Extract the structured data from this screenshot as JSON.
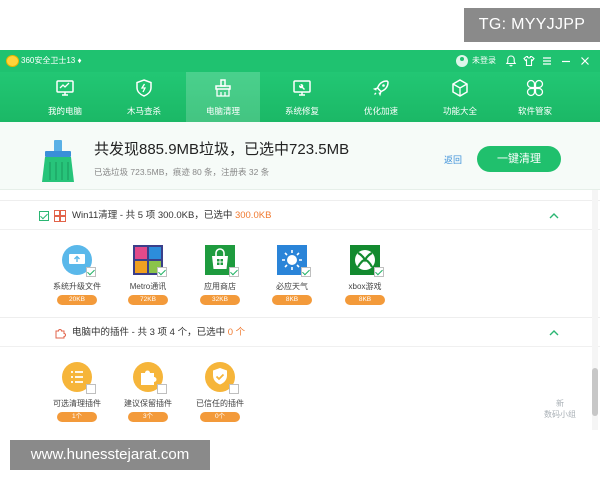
{
  "watermarks": {
    "top": "TG: MYYJJPP",
    "bottom": "www.hunesstejarat.com",
    "corner": [
      "新",
      "数码小组"
    ]
  },
  "titlebar": {
    "title": "360安全卫士13 ♦",
    "login": "未登录",
    "controls": [
      "bell-icon",
      "shirt-icon",
      "menu-icon",
      "minimize-icon",
      "close-icon"
    ]
  },
  "nav": {
    "items": [
      {
        "label": "我的电脑",
        "icon": "monitor-icon"
      },
      {
        "label": "木马查杀",
        "icon": "shield-icon"
      },
      {
        "label": "电脑清理",
        "icon": "broom-icon",
        "active": true
      },
      {
        "label": "系统修复",
        "icon": "wrench-icon"
      },
      {
        "label": "优化加速",
        "icon": "rocket-icon"
      },
      {
        "label": "功能大全",
        "icon": "cube-icon"
      },
      {
        "label": "软件管家",
        "icon": "grid-icon"
      }
    ]
  },
  "summary": {
    "headline": "共发现885.9MB垃圾，已选中723.5MB",
    "subline": "已选垃圾 723.5MB，痕迹 80 条，注册表 32 条",
    "back": "返回",
    "clean_button": "一键清理"
  },
  "section1": {
    "title_prefix": "Win11清理 - 共 5 项 300.0KB，已选中 ",
    "title_highlight": "300.0KB",
    "tiles": [
      {
        "label": "系统升级文件",
        "size": "20KB",
        "icon": "system-update-icon"
      },
      {
        "label": "Metro通讯",
        "size": "72KB",
        "icon": "metro-apps-icon"
      },
      {
        "label": "应用商店",
        "size": "32KB",
        "icon": "app-store-icon"
      },
      {
        "label": "必应天气",
        "size": "8KB",
        "icon": "weather-icon"
      },
      {
        "label": "xbox游戏",
        "size": "8KB",
        "icon": "xbox-icon"
      }
    ]
  },
  "section2": {
    "title_prefix": "电脑中的插件 - 共 3 项 4 个，已选中 ",
    "title_highlight": "0 个",
    "tiles": [
      {
        "label": "可选清理插件",
        "size": "1个",
        "icon": "plugin-list-icon"
      },
      {
        "label": "建议保留插件",
        "size": "3个",
        "icon": "puzzle-icon"
      },
      {
        "label": "已信任的插件",
        "size": "0个",
        "icon": "trusted-check-icon"
      }
    ]
  },
  "colors": {
    "brand_green": "#1fc270",
    "accent_orange": "#f07a30",
    "link_blue": "#3a8fd9"
  }
}
